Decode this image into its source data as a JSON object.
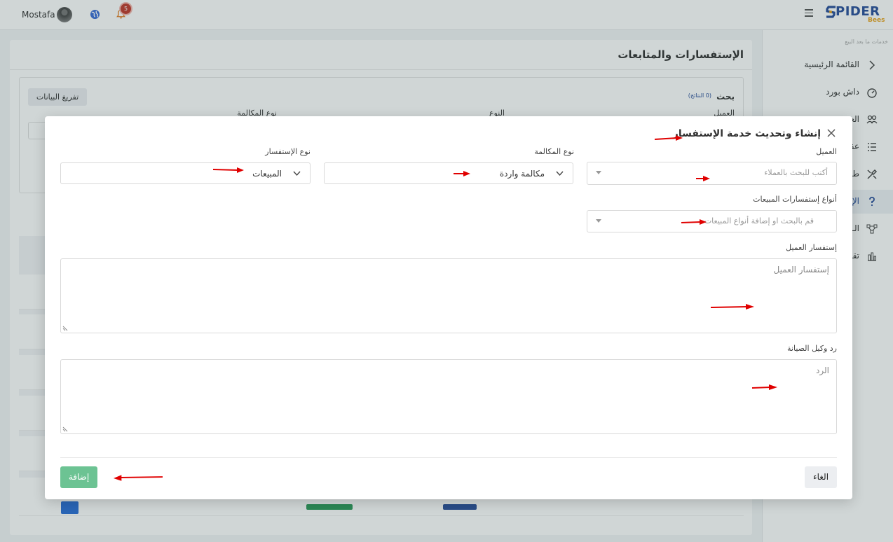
{
  "topbar": {
    "user_name": "Mostafa",
    "notification_count": "5",
    "logo_text": "PIDER",
    "logo_sub": "Bees"
  },
  "sidebar": {
    "caption": "خدمات ما بعد البيع",
    "items": [
      {
        "label": "القائمة الرئيسية",
        "icon": "chevron-right-icon"
      },
      {
        "label": "داش بورد",
        "icon": "dashboard-gauge-icon"
      },
      {
        "label": "العـ",
        "icon": "users-icon"
      },
      {
        "label": "عقـ",
        "icon": "list-icon"
      },
      {
        "label": "طـ",
        "icon": "tools-icon"
      },
      {
        "label": "الإ",
        "icon": "question-icon"
      },
      {
        "label": "الـ",
        "icon": "flow-icon"
      },
      {
        "label": "تقـ",
        "icon": "bar-chart-icon"
      }
    ]
  },
  "page": {
    "title": "الإستفسارات والمتابعات",
    "search_title": "بحث",
    "search_count": "(0 النتائج)",
    "clear_button": "تفريغ البيانات",
    "labels": {
      "customer": "العميل",
      "type": "النوع",
      "call_type": "نوع المكالمة"
    }
  },
  "modal": {
    "title": "إنشاء وتحديث خدمة الإستفسار",
    "customer": {
      "label": "العميل",
      "placeholder": "أكتب للبحث بالعملاء"
    },
    "call_type": {
      "label": "نوع المكالمة",
      "value": "مكالمة واردة"
    },
    "inquiry_type": {
      "label": "نوع الإستفسار",
      "value": "المبيعات"
    },
    "sales_types": {
      "label": "أنواع إستفسارات المبيعات",
      "placeholder": "قم بالبحث او إضافة أنواع المبيعات"
    },
    "customer_inquiry": {
      "label": "إستفسار العميل",
      "placeholder": "إستفسار العميل"
    },
    "agent_reply": {
      "label": "رد وكيل الصيانة",
      "placeholder": "الرد"
    },
    "add_button": "إضافة",
    "cancel_button": "الغاء"
  },
  "colors": {
    "accent": "#2a4f9a",
    "brand_orange": "#e8a21c",
    "add_button": "#6cc393",
    "annotation_arrow": "#e00000"
  }
}
